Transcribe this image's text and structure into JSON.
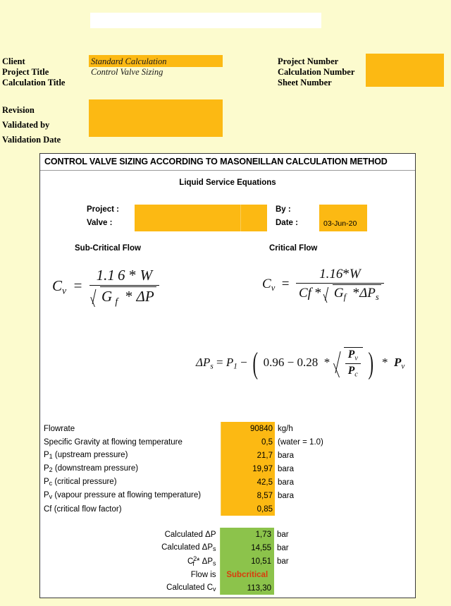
{
  "page": {
    "background_color": "#fcfbce",
    "accent_input_color": "#fcb913",
    "result_color": "#8cc34b",
    "alert_color": "#d93b0b"
  },
  "header": {
    "left_labels": [
      "Client",
      "Project Title",
      "Calculation Title"
    ],
    "left_values": [
      "",
      "Standard Calculation",
      "Control Valve Sizing"
    ],
    "right_labels": [
      "Project Number",
      "Calculation Number",
      "Sheet Number"
    ],
    "right_values": [
      "",
      "",
      ""
    ],
    "revision_labels": [
      "Revision",
      "Validated by",
      "Validation Date"
    ],
    "revision_values": [
      "",
      "",
      ""
    ]
  },
  "calc": {
    "title": "CONTROL VALVE SIZING ACCORDING TO MASONEILLAN CALCULATION METHOD",
    "subtitle": "Liquid Service Equations",
    "project_label": "Project :",
    "project_value": "",
    "valve_label": "Valve :",
    "valve_value": "",
    "by_label": "By :",
    "by_value": "",
    "date_label": "Date :",
    "date_value": "03-Jun-20"
  },
  "equations": {
    "subcritical_heading": "Sub-Critical Flow",
    "critical_heading": "Critical Flow",
    "subcritical_formula": "Cv = 1.16 * W / sqrt(Gf * dP)",
    "critical_formula": "Cv = 1.16*W / (Cf * sqrt(Gf * dPs))",
    "dps_formula": "dPs = P1 - (0.96 - 0.28 * sqrt(Pv/Pc)) * Pv",
    "tokens": {
      "cv": "C",
      "cv_sub": "v",
      "eq": "=",
      "const_116_a": "1.1 6",
      "const_116_b": "1.16",
      "star": "*",
      "w": "W",
      "g": "G",
      "g_sub": "f",
      "delta_p": "ΔP",
      "cf": "Cf",
      "delta_ps": "ΔP",
      "delta_ps_sub": "s",
      "p1": "P",
      "p1_sub": "1",
      "minus": "−",
      "const_096": "0.96",
      "const_028": "0.28",
      "pv": "P",
      "pv_sub": "v",
      "pc": "P",
      "pc_sub": "c"
    }
  },
  "inputs": {
    "rows": [
      {
        "label": "Flowrate",
        "value": "90840",
        "unit": "kg/h"
      },
      {
        "label": "Specific Gravity at flowing temperature",
        "value": "0,5",
        "unit": "(water = 1.0)"
      },
      {
        "label_pre": "P",
        "label_sub": "1",
        "label_post": " (upstream pressure)",
        "value": "21,7",
        "unit": "bara"
      },
      {
        "label_pre": "P",
        "label_sub": "2",
        "label_post": " (downstream pressure)",
        "value": "19,97",
        "unit": "bara"
      },
      {
        "label_pre": "P",
        "label_sub": "c",
        "label_post": " (critical pressure)",
        "value": "42,5",
        "unit": "bara"
      },
      {
        "label_pre": "P",
        "label_sub": "v",
        "label_post": " (vapour pressure at flowing temperature)",
        "value": "8,57",
        "unit": "bara"
      },
      {
        "label": "Cf (critical flow factor)",
        "value": "0,85",
        "unit": ""
      }
    ]
  },
  "results": {
    "rows": [
      {
        "label_pre": "Calculated ΔP",
        "label_sub": "",
        "value": "1,73",
        "unit": "bar"
      },
      {
        "label_pre": "Calculated ΔP",
        "label_sub": "s",
        "value": "14,55",
        "unit": "bar"
      },
      {
        "label_pre": "C",
        "label_sub2": "f",
        "label_sup": "2",
        "label_mid": " * ΔP",
        "label_sub": "s",
        "value": "10,51",
        "unit": "bar"
      },
      {
        "label_pre": "Flow is",
        "value": "Subcritical",
        "unit": "",
        "is_alert": true
      },
      {
        "label_pre": "Calculated C",
        "label_sub": "v",
        "value": "113,30",
        "unit": ""
      }
    ]
  }
}
